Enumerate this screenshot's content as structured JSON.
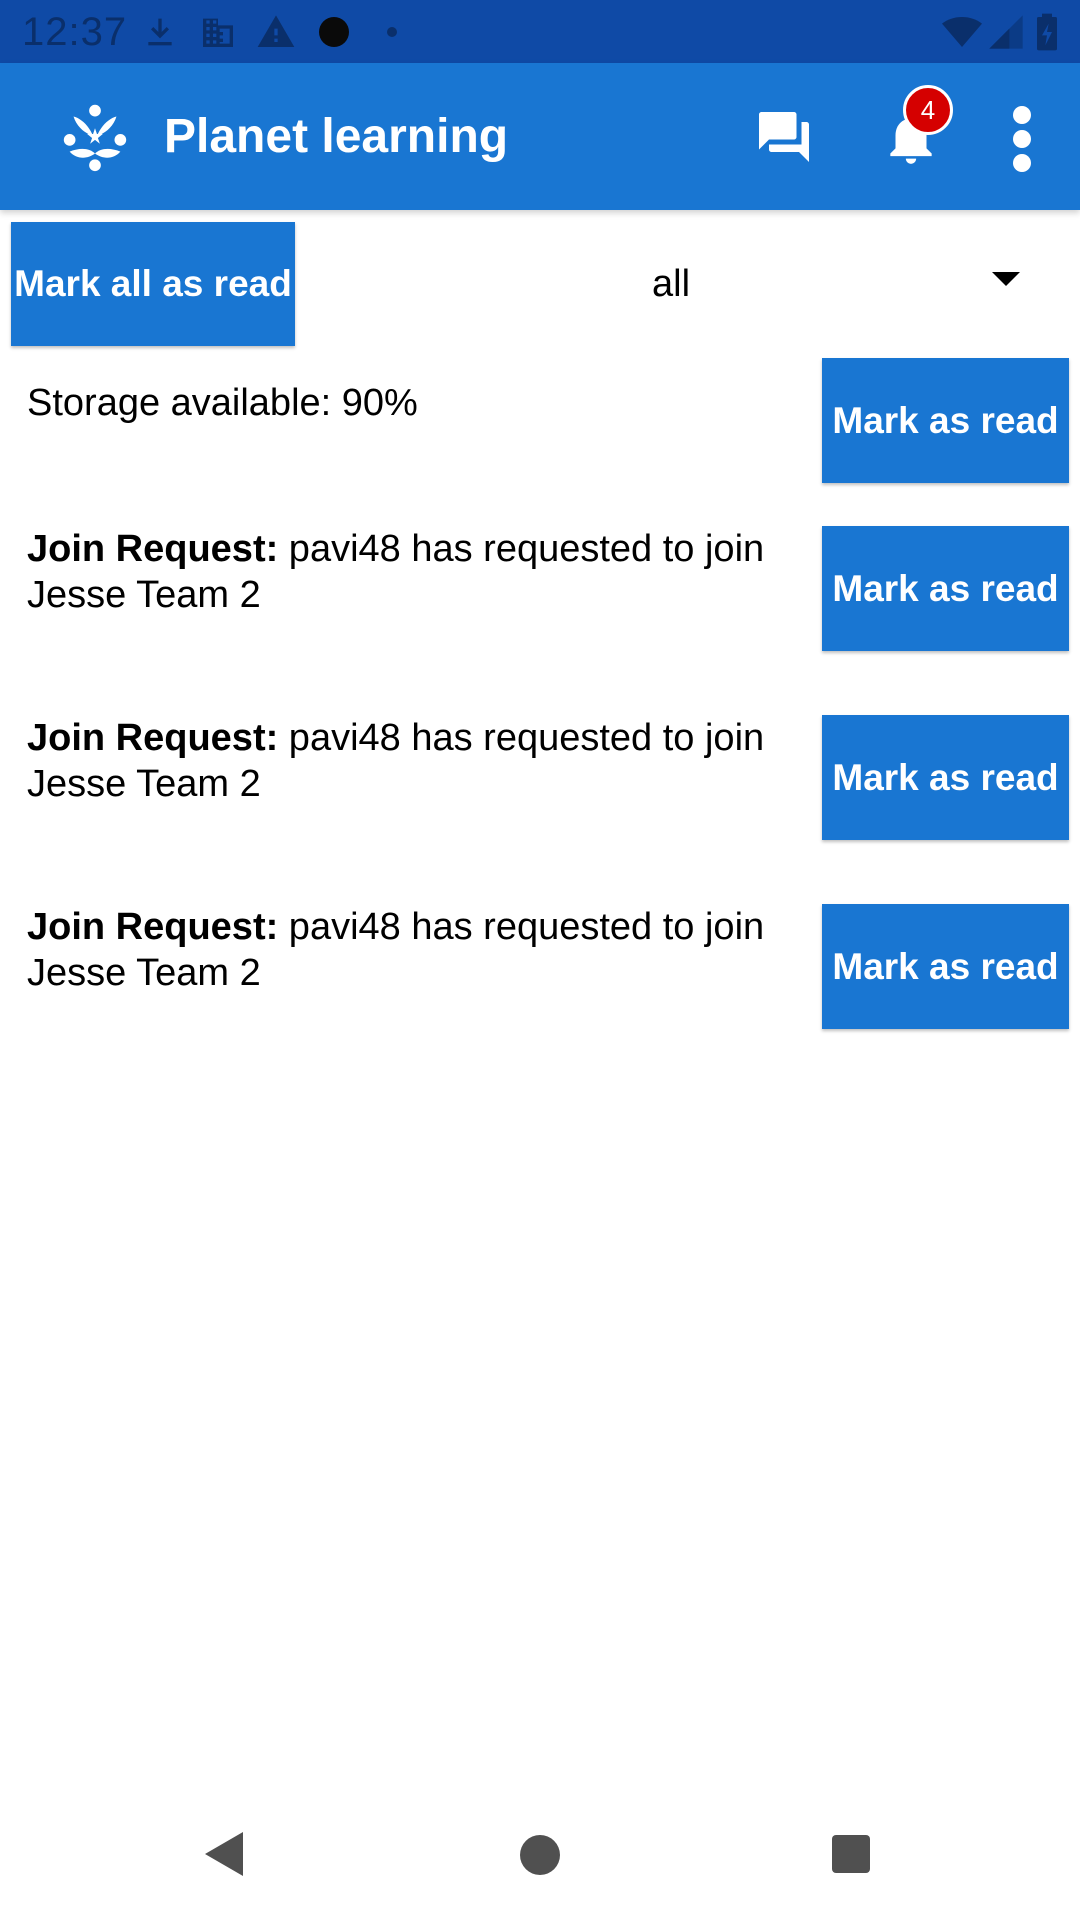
{
  "status_bar": {
    "time": "12:37",
    "icons": [
      "download-icon",
      "building-icon",
      "warning-icon",
      "circle-icon",
      "dot-icon",
      "wifi-icon",
      "signal-icon",
      "battery-icon"
    ]
  },
  "app_bar": {
    "title": "Planet learning",
    "logo": "planet-logo-icon",
    "chat_icon": "chat-icon",
    "bell_icon": "bell-icon",
    "notification_count": "4",
    "more_icon": "more-vert-icon"
  },
  "toolbar": {
    "mark_all_label": "Mark all as read",
    "filter_value": "all"
  },
  "notifications": [
    {
      "title": "",
      "text": "Storage available: 90%",
      "button_label": "Mark as read"
    },
    {
      "title": "Join Request:",
      "text": " pavi48 has requested to join Jesse Team 2",
      "button_label": "Mark as read"
    },
    {
      "title": "Join Request:",
      "text": " pavi48 has requested to join Jesse Team 2",
      "button_label": "Mark as read"
    },
    {
      "title": "Join Request:",
      "text": " pavi48 has requested to join Jesse Team 2",
      "button_label": "Mark as read"
    }
  ],
  "colors": {
    "primary": "#1976d2",
    "status_bar": "#0f4aa6",
    "badge": "#d50000"
  }
}
